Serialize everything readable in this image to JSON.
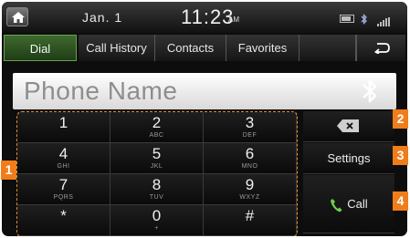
{
  "status": {
    "date": "Jan.  1",
    "time": "11:23",
    "ampm": "AM"
  },
  "tabs": [
    {
      "label": "Dial",
      "active": true
    },
    {
      "label": "Call History",
      "active": false
    },
    {
      "label": "Contacts",
      "active": false
    },
    {
      "label": "Favorites",
      "active": false
    }
  ],
  "phone_field": {
    "text": "Phone Name"
  },
  "keypad": [
    {
      "digit": "1",
      "letters": ""
    },
    {
      "digit": "2",
      "letters": "ABC"
    },
    {
      "digit": "3",
      "letters": "DEF"
    },
    {
      "digit": "4",
      "letters": "GHI"
    },
    {
      "digit": "5",
      "letters": "JKL"
    },
    {
      "digit": "6",
      "letters": "MNO"
    },
    {
      "digit": "7",
      "letters": "PQRS"
    },
    {
      "digit": "8",
      "letters": "TUV"
    },
    {
      "digit": "9",
      "letters": "WXYZ"
    },
    {
      "digit": "*",
      "letters": ""
    },
    {
      "digit": "0",
      "letters": "+"
    },
    {
      "digit": "#",
      "letters": ""
    }
  ],
  "side": {
    "settings_label": "Settings",
    "call_label": "Call"
  },
  "badges": {
    "b1": "1",
    "b2": "2",
    "b3": "3",
    "b4": "4"
  },
  "colors": {
    "badge": "#f07d1a",
    "active_tab": "#3f6a2f",
    "call_icon": "#6fd14a"
  }
}
